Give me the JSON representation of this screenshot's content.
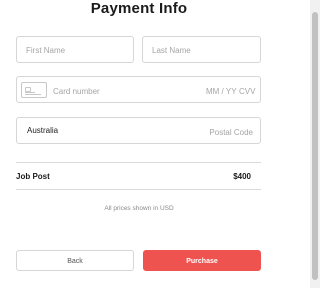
{
  "title": "Payment Info",
  "name_fields": {
    "first_placeholder": "First Name",
    "last_placeholder": "Last Name"
  },
  "card": {
    "number_placeholder": "Card number",
    "expiry_placeholder": "MM / YY",
    "cvv_placeholder": "CVV",
    "icon": "credit-card-icon"
  },
  "address": {
    "country": "Australia",
    "postal_placeholder": "Postal Code"
  },
  "summary": {
    "item": "Job Post",
    "price": "$400"
  },
  "note": "All prices shown in USD",
  "buttons": {
    "back": "Back",
    "purchase": "Purchase"
  },
  "colors": {
    "accent": "#ef5350",
    "border": "#d6d6d6"
  }
}
